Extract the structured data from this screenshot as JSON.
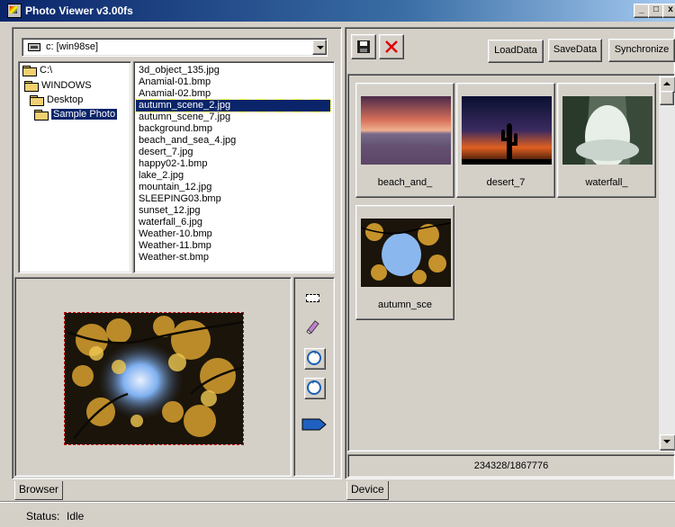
{
  "window": {
    "title": "Photo Viewer v3.00fs",
    "min_glyph": "_",
    "max_glyph": "□",
    "close_glyph": "x"
  },
  "drive": {
    "label": "c: [win98se]"
  },
  "folders": [
    {
      "label": "C:\\"
    },
    {
      "label": "WINDOWS"
    },
    {
      "label": "Desktop"
    },
    {
      "label": "Sample Photo"
    }
  ],
  "files": [
    "3d_object_135.jpg",
    "Anamial-01.bmp",
    "Anamial-02.bmp",
    "autumn_scene_2.jpg",
    "autumn_scene_7.jpg",
    "background.bmp",
    "beach_and_sea_4.jpg",
    "desert_7.jpg",
    "happy02-1.bmp",
    "lake_2.jpg",
    "mountain_12.jpg",
    "SLEEPING03.bmp",
    "sunset_12.jpg",
    "waterfall_6.jpg",
    "Weather-10.bmp",
    "Weather-11.bmp",
    "Weather-st.bmp"
  ],
  "selected_file": "autumn_scene_2.jpg",
  "device_toolbar": {
    "load": "LoadData",
    "save": "SaveData",
    "sync": "Synchronize"
  },
  "thumbnails": [
    {
      "caption": "beach_and_"
    },
    {
      "caption": "desert_7"
    },
    {
      "caption": "waterfall_"
    },
    {
      "caption": "autumn_sce"
    }
  ],
  "storage": "234328/1867776",
  "tabs": {
    "browser": "Browser",
    "device": "Device"
  },
  "status": {
    "label": "Status:",
    "value": "Idle"
  }
}
